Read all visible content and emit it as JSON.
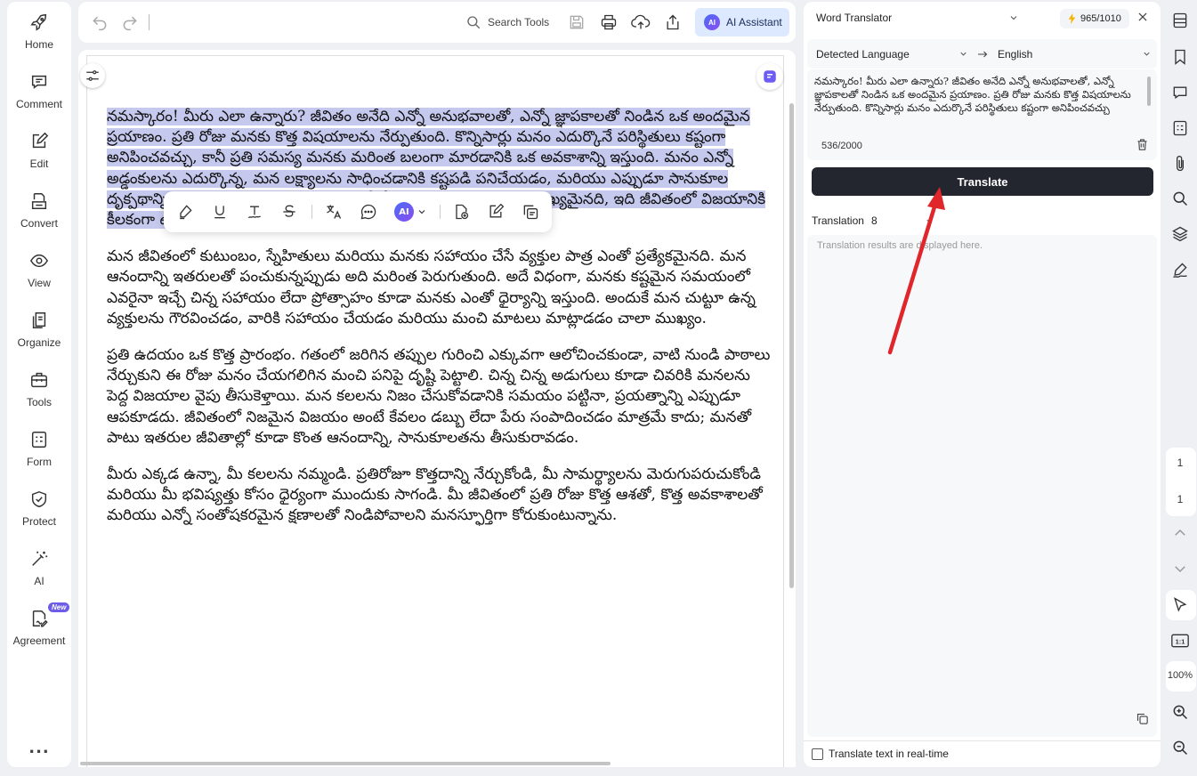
{
  "sidebar": {
    "items": [
      {
        "label": "Home",
        "icon": "rocket-icon"
      },
      {
        "label": "Comment",
        "icon": "comment-icon"
      },
      {
        "label": "Edit",
        "icon": "edit-icon"
      },
      {
        "label": "Convert",
        "icon": "convert-icon"
      },
      {
        "label": "View",
        "icon": "eye-icon"
      },
      {
        "label": "Organize",
        "icon": "organize-icon"
      },
      {
        "label": "Tools",
        "icon": "toolbox-icon"
      },
      {
        "label": "Form",
        "icon": "form-icon"
      },
      {
        "label": "Protect",
        "icon": "shield-icon"
      },
      {
        "label": "AI",
        "icon": "magic-wand-icon"
      },
      {
        "label": "Agreement",
        "icon": "agreement-icon",
        "badge": "New"
      }
    ],
    "more": "..."
  },
  "toolbar": {
    "search_label": "Search Tools",
    "ai_logo": "AI",
    "ai_assistant_label": "AI Assistant"
  },
  "format_bar": {
    "ai_label": "AI"
  },
  "document": {
    "selected_paragraph": "నమస్కారం! మీరు ఎలా ఉన్నారు? జీవితం అనేది ఎన్నో అనుభవాలతో, ఎన్నో జ్ఞాపకాలతో నిండిన ఒక అందమైన ప్రయాణం. ప్రతి రోజు మనకు కొత్త విషయాలను నేర్పుతుంది. కొన్నిసార్లు మనం ఎదుర్కొనే పరిస్థితులు కష్టంగా అనిపించవచ్చు, కానీ ప్రతి సమస్య మనకు మరింత బలంగా మారడానికి ఒక అవకాశాన్ని ఇస్తుంది. మనం ఎన్నో అడ్డంకులను ఎదుర్కొన్న, మన లక్ష్యాలను సాధించడానికి కష్టపడి పనిచేయడం, మరియు ఎప్పుడూ సానుకూల దృక్పథాన్ని కొనసాగించడం, ఆత్మవిశ్వాసాన్ని కోల్పోకుండా ఉండటం చాలా ముఖ్యమైనది, ఇది జీవితంలో విజయానికి కీలకంగా ఉంచడం చాలా ముఖ్యం.",
    "paragraphs": [
      "మన జీవితంలో కుటుంబం, స్నేహితులు మరియు మనకు సహాయం చేసే వ్యక్తుల పాత్ర ఎంతో ప్రత్యేకమైనది. మన ఆనందాన్ని ఇతరులతో పంచుకున్నప్పుడు అది మరింత పెరుగుతుంది. అదే విధంగా, మనకు కష్టమైన సమయంలో ఎవరైనా ఇచ్చే చిన్న సహాయం లేదా ప్రోత్సాహం కూడా మనకు ఎంతో ధైర్యాన్ని ఇస్తుంది. అందుకే మన చుట్టూ ఉన్న వ్యక్తులను గౌరవించడం, వారికి సహాయం చేయడం మరియు మంచి మాటలు మాట్లాడడం చాలా ముఖ్యం.",
      "ప్రతి ఉదయం ఒక కొత్త ప్రారంభం. గతంలో జరిగిన తప్పుల గురించి ఎక్కువగా ఆలోచించకుండా, వాటి నుండి పాఠాలు నేర్చుకుని ఈ రోజు మనం చేయగలిగిన మంచి పనిపై దృష్టి పెట్టాలి. చిన్న చిన్న అడుగులు కూడా చివరికి మనలను పెద్ద విజయాల వైపు తీసుకెళ్తాయి. మన కలలను నిజం చేసుకోవడానికి సమయం పట్టినా, ప్రయత్నాన్ని ఎప్పుడూ ఆపకూడదు. జీవితంలో నిజమైన విజయం అంటే కేవలం డబ్బు లేదా పేరు సంపాదించడం మాత్రమే కాదు; మనతో పాటు ఇతరుల జీవితాల్లో కూడా కొంత ఆనందాన్ని, సానుకూలతను తీసుకురావడం.",
      "మీరు ఎక్కడ ఉన్నా, మీ కలలను నమ్మండి. ప్రతిరోజూ కొత్తదాన్ని నేర్చుకోండి, మీ సామర్థ్యాలను మెరుగుపరుచుకోండి మరియు మీ భవిష్యత్తు కోసం ధైర్యంగా ముందుకు సాగండి. మీ జీవితంలో ప్రతి రోజు కొత్త ఆశతో, కొత్త అవకాశాలతో మరియు ఎన్నో సంతోషకరమైన క్షణాలతో నిండిపోవాలని మనస్ఫూర్తిగా కోరుకుంటున్నాను."
    ]
  },
  "translator": {
    "title": "Word Translator",
    "credits": "965/1010",
    "source_lang": "Detected Language",
    "target_lang": "English",
    "source_text": "నమస్కారం! మీరు ఎలా ఉన్నారు? జీవితం అనేది ఎన్నో అనుభవాలతో, ఎన్నో జ్ఞాపకాలతో నిండిన ఒక అందమైన ప్రయాణం. ప్రతి రోజు మనకు కొత్త విషయాలను నేర్పుతుంది. కొన్నిసార్లు మనం ఎదుర్కొనే పరిస్థితులు కష్టంగా అనిపించవచ్చు",
    "char_count": "536/2000",
    "translate_label": "Translate",
    "translation_label": "Translation",
    "translation_option": "8",
    "result_placeholder": "Translation results are displayed here.",
    "realtime_label": "Translate text in real-time"
  },
  "right_bar": {
    "page_current": "1",
    "page_total": "1",
    "zoom": "100%",
    "fit_label": "1:1"
  },
  "colors": {
    "selection": "#c6c9ee",
    "translate_button": "#23262f",
    "ai_button_bg": "#dde9ff",
    "annotation_arrow": "#e0252b",
    "new_badge": "#6c5ce7"
  }
}
